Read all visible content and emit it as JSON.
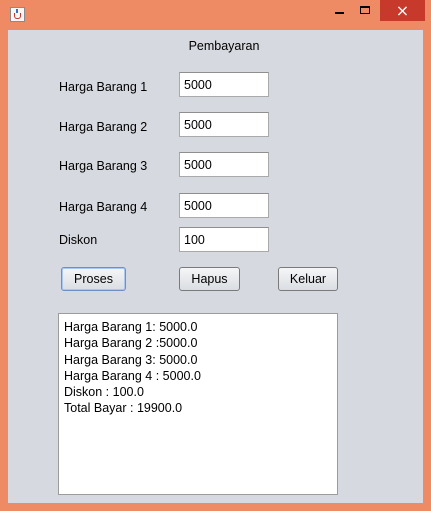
{
  "window": {
    "title": "",
    "controls": {
      "minimize": "minimize",
      "maximize": "maximize",
      "close": "×"
    }
  },
  "form": {
    "title": "Pembayaran",
    "fields": [
      {
        "label": "Harga Barang 1",
        "value": "5000"
      },
      {
        "label": "Harga Barang 2",
        "value": "5000"
      },
      {
        "label": "Harga Barang 3",
        "value": "5000"
      },
      {
        "label": "Harga Barang 4",
        "value": "5000"
      },
      {
        "label": "Diskon",
        "value": "100"
      }
    ],
    "buttons": {
      "proses": "Proses",
      "hapus": "Hapus",
      "keluar": "Keluar"
    },
    "output_lines": [
      "Harga Barang 1: 5000.0",
      "Harga Barang 2 :5000.0",
      "Harga Barang 3: 5000.0",
      "Harga Barang 4 : 5000.0",
      "Diskon : 100.0",
      "Total Bayar : 19900.0"
    ]
  }
}
